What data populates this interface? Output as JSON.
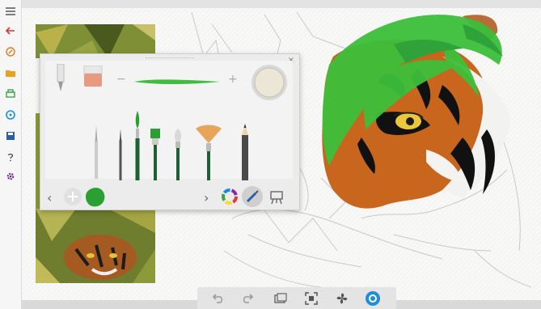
{
  "app": {
    "colors": {
      "accent": "#1e8ed6",
      "brush_green": "#3cbf3a",
      "left_bar": "#f6f6f6",
      "canvas": "#f9f9f8"
    }
  },
  "appbar": {
    "items": [
      {
        "name": "menu-icon",
        "color": "#555555"
      },
      {
        "name": "back-arrow-icon",
        "color": "#d9342b"
      },
      {
        "name": "new-drawing-icon",
        "color": "#e07a1f"
      },
      {
        "name": "open-folder-icon",
        "color": "#e9a21a"
      },
      {
        "name": "print-icon",
        "color": "#2b9e3a"
      },
      {
        "name": "share-icon",
        "color": "#1e8ed6"
      },
      {
        "name": "save-icon",
        "color": "#2a5fa8"
      },
      {
        "name": "help-icon",
        "color": "#555555"
      },
      {
        "name": "settings-icon",
        "color": "#7a2f8f"
      }
    ]
  },
  "panel": {
    "close_glyph": "×",
    "minus_glyph": "−",
    "plus_glyph": "+",
    "stroke_color": "#3cbf3a",
    "tools": [
      "pencil-nib",
      "eraser",
      "paint-bucket",
      "round-brush-fine",
      "liner-brush",
      "round-brush-green",
      "flat-brush",
      "filbert-brush",
      "fan-brush",
      "graphite-pencil"
    ],
    "selected_color": "#2aa033",
    "prev_glyph": "‹",
    "next_glyph": "›"
  },
  "dock": {
    "items": [
      "undo-icon",
      "redo-icon",
      "layers-icon",
      "fit-screen-icon",
      "fan-icon",
      "reference-icon"
    ]
  }
}
